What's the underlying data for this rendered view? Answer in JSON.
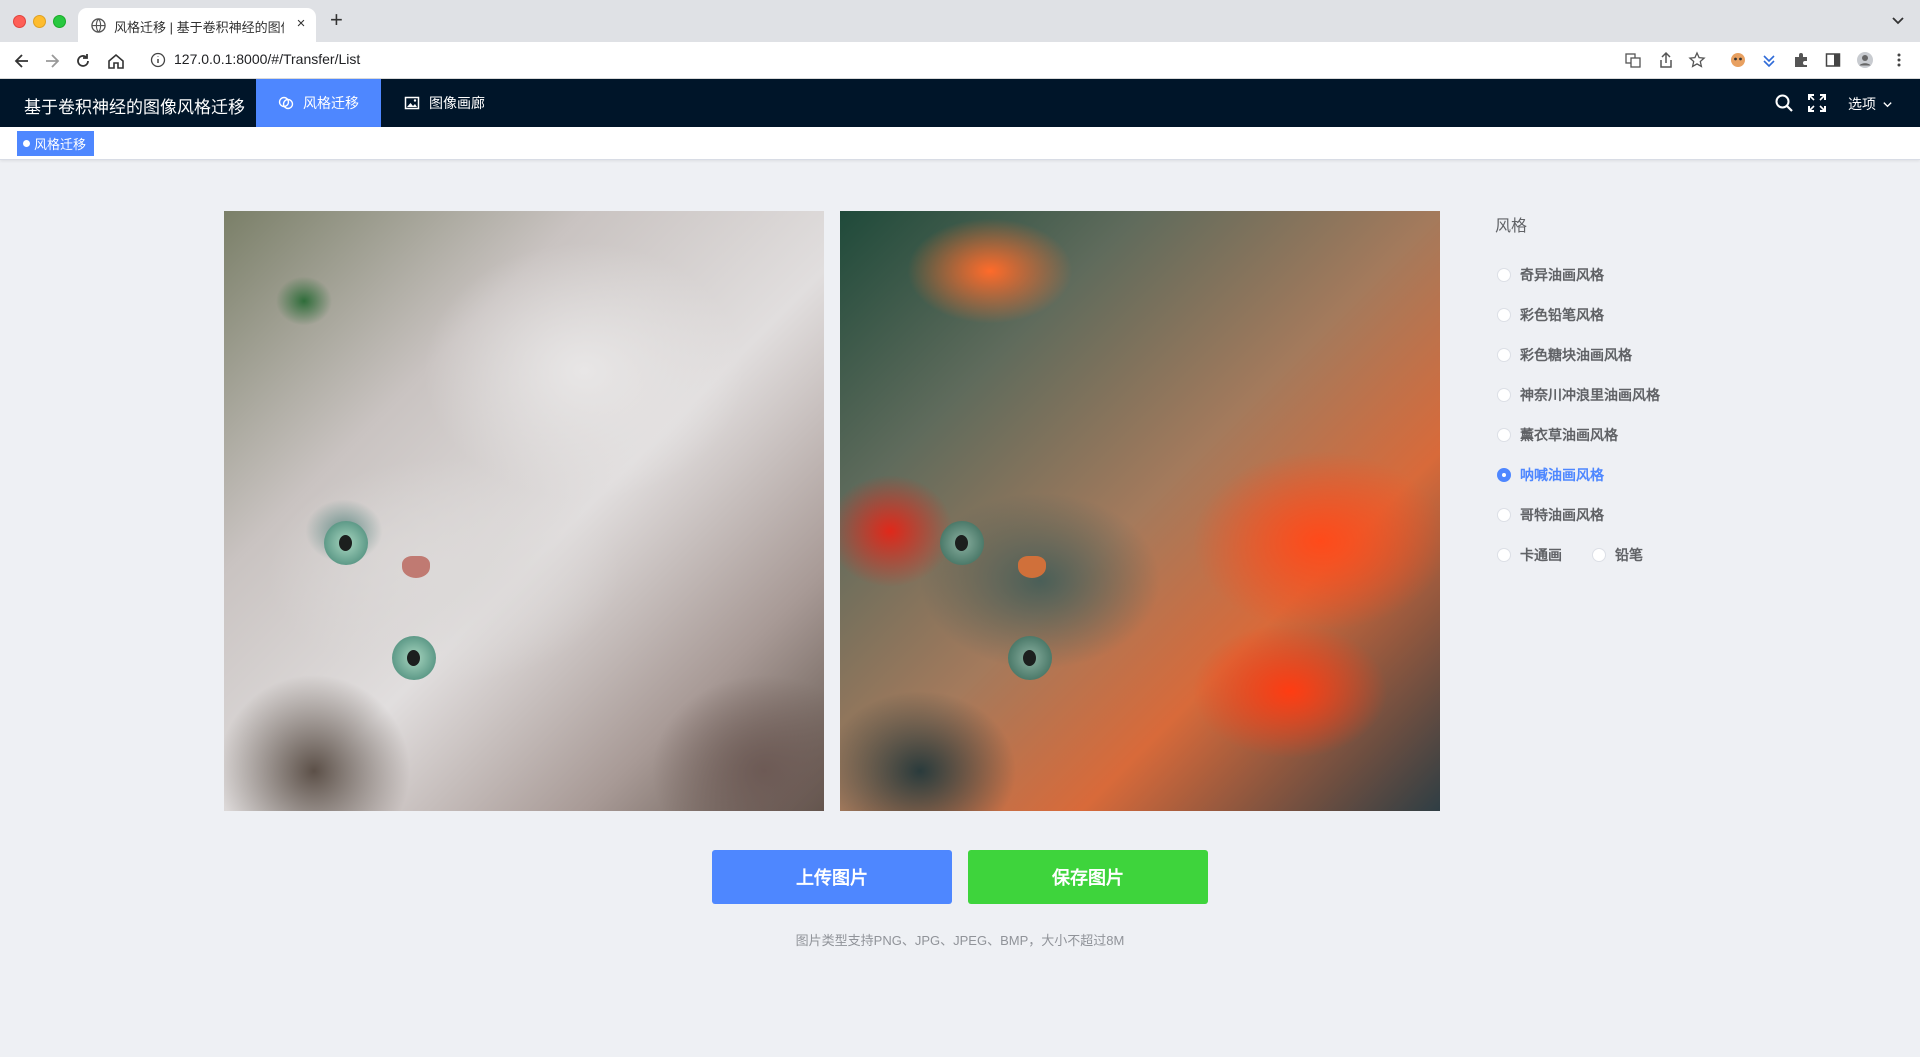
{
  "browser": {
    "tab_title": "风格迁移 | 基于卷积神经的图像风格迁移",
    "tab_close": "×",
    "new_tab": "+",
    "url": "127.0.0.1:8000/#/Transfer/List"
  },
  "header": {
    "title": "基于卷积神经的图像风格迁移",
    "menu": [
      {
        "label": "风格迁移",
        "icon": "style-transfer-icon",
        "active": true
      },
      {
        "label": "图像画廊",
        "icon": "picture-icon",
        "active": false
      }
    ],
    "options_label": "选项"
  },
  "tags": {
    "active_tag": "风格迁移"
  },
  "images": {
    "original_alt": "原始图片",
    "styled_alt": "风格迁移结果"
  },
  "style_panel": {
    "title": "风格",
    "options": [
      {
        "label": "奇异油画风格",
        "checked": false
      },
      {
        "label": "彩色铅笔风格",
        "checked": false
      },
      {
        "label": "彩色糖块油画风格",
        "checked": false
      },
      {
        "label": "神奈川冲浪里油画风格",
        "checked": false
      },
      {
        "label": "薰衣草油画风格",
        "checked": false
      },
      {
        "label": "呐喊油画风格",
        "checked": true
      },
      {
        "label": "哥特油画风格",
        "checked": false
      },
      {
        "label": "卡通画",
        "checked": false
      },
      {
        "label": "铅笔",
        "checked": false
      }
    ]
  },
  "actions": {
    "upload_label": "上传图片",
    "save_label": "保存图片",
    "hint": "图片类型支持PNG、JPG、JPEG、BMP，大小不超过8M"
  },
  "colors": {
    "primary": "#4e87ff",
    "success": "#3ed43c",
    "header_bg": "#001529",
    "page_bg": "#eef0f4"
  }
}
